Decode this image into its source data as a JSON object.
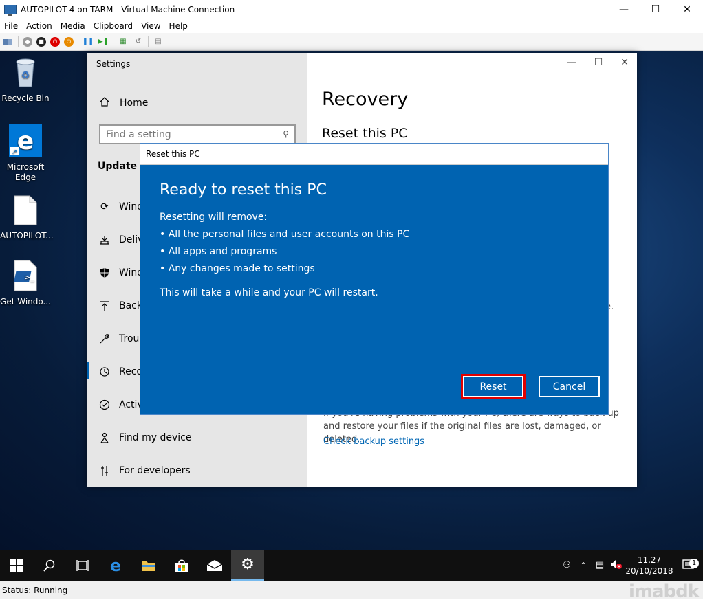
{
  "host": {
    "title": "AUTOPILOT-4 on TARM - Virtual Machine Connection",
    "menu": [
      "File",
      "Action",
      "Media",
      "Clipboard",
      "View",
      "Help"
    ],
    "status": "Status: Running",
    "watermark": "imabdk"
  },
  "desktop": {
    "icons": [
      {
        "label": "Recycle Bin",
        "icon": "recycle-bin-icon"
      },
      {
        "label": "Microsoft Edge",
        "icon": "edge-icon"
      },
      {
        "label": "AUTOPILOT...",
        "icon": "file-icon"
      },
      {
        "label": "Get-Windo...",
        "icon": "powershell-script-icon"
      }
    ]
  },
  "settings": {
    "window_title": "Settings",
    "home_label": "Home",
    "search_placeholder": "Find a setting",
    "section_title": "Update &",
    "nav_items": [
      {
        "label": "Windo",
        "icon": "sync-icon"
      },
      {
        "label": "Deliv",
        "icon": "delivery-icon"
      },
      {
        "label": "Windo",
        "icon": "shield-icon"
      },
      {
        "label": "Backu",
        "icon": "backup-icon"
      },
      {
        "label": "Troul",
        "icon": "wrench-icon"
      },
      {
        "label": "Reco",
        "icon": "history-icon"
      },
      {
        "label": "Activ",
        "icon": "check-circle-icon"
      },
      {
        "label": "Find my device",
        "icon": "person-icon"
      },
      {
        "label": "For developers",
        "icon": "developer-icon"
      }
    ],
    "active_item": "Reco",
    "page_title": "Recovery",
    "section_heading": "Reset this PC",
    "backup_text": "If you're having problems with your PC, there are ways to back up and restore your files if the original files are lost, damaged, or deleted.",
    "backup_link": "Check backup settings",
    "partial_text": "e."
  },
  "dialog": {
    "title": "Reset this PC",
    "heading": "Ready to reset this PC",
    "intro": "Resetting will remove:",
    "bullets": [
      "• All the personal files and user accounts on this PC",
      "• All apps and programs",
      "• Any changes made to settings"
    ],
    "footer": "This will take a while and your PC will restart.",
    "reset_label": "Reset",
    "cancel_label": "Cancel"
  },
  "taskbar": {
    "time": "11.27",
    "date": "20/10/2018",
    "notification_count": "1"
  },
  "colors": {
    "dialog_bg": "#0063b1",
    "highlight": "#e00000",
    "link": "#0066b4"
  }
}
